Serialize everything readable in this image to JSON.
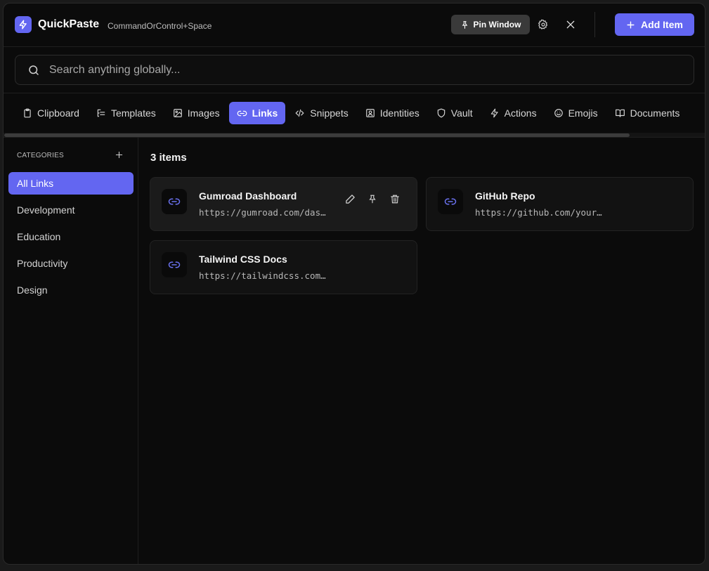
{
  "app": {
    "title": "QuickPaste",
    "shortcut": "CommandOrControl+Space",
    "pin_label": "Pin Window",
    "add_label": "Add Item"
  },
  "search": {
    "placeholder": "Search anything globally..."
  },
  "tabs": [
    {
      "label": "Clipboard",
      "icon": "clipboard-icon"
    },
    {
      "label": "Templates",
      "icon": "templates-icon"
    },
    {
      "label": "Images",
      "icon": "image-icon"
    },
    {
      "label": "Links",
      "icon": "link-icon",
      "active": true
    },
    {
      "label": "Snippets",
      "icon": "code-icon"
    },
    {
      "label": "Identities",
      "icon": "identity-icon"
    },
    {
      "label": "Vault",
      "icon": "shield-icon"
    },
    {
      "label": "Actions",
      "icon": "bolt-icon"
    },
    {
      "label": "Emojis",
      "icon": "smile-icon"
    },
    {
      "label": "Documents",
      "icon": "book-icon"
    }
  ],
  "sidebar": {
    "header": "CATEGORIES",
    "items": [
      "All Links",
      "Development",
      "Education",
      "Productivity",
      "Design"
    ]
  },
  "main": {
    "count": "3 items",
    "cards": [
      {
        "title": "Gumroad Dashboard",
        "url": "https://gumroad.com/dashboard"
      },
      {
        "title": "GitHub Repo",
        "url": "https://github.com/your-username"
      },
      {
        "title": "Tailwind CSS Docs",
        "url": "https://tailwindcss.com/docs"
      }
    ]
  },
  "colors": {
    "accent": "#6366f1",
    "background": "#0b0b0b",
    "card": "#121212"
  }
}
